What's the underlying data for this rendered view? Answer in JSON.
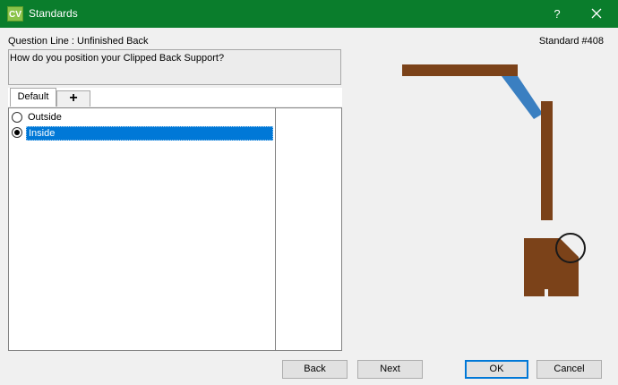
{
  "window": {
    "app_icon_text": "CV",
    "title": "Standards",
    "help_label": "?"
  },
  "header": {
    "question_line": "Question Line : Unfinished Back",
    "standard_number": "Standard #408"
  },
  "question": {
    "text": "How do you position your Clipped Back Support?"
  },
  "tabs": [
    {
      "label": "Default",
      "active": true
    },
    {
      "label": "+",
      "active": false
    }
  ],
  "options": [
    {
      "label": "Outside",
      "checked": false
    },
    {
      "label": "Inside",
      "checked": true
    }
  ],
  "preview": {
    "wood_color": "#7b4219",
    "support_color": "#3a7fc1",
    "icons": [
      "clipped-back-diagram",
      "corner-joint-diagram",
      "magnifier-circle-icon"
    ]
  },
  "buttons": {
    "back": "Back",
    "next": "Next",
    "ok": "OK",
    "cancel": "Cancel"
  },
  "colors": {
    "titlebar": "#0a7d2c",
    "selection": "#0078d7"
  }
}
